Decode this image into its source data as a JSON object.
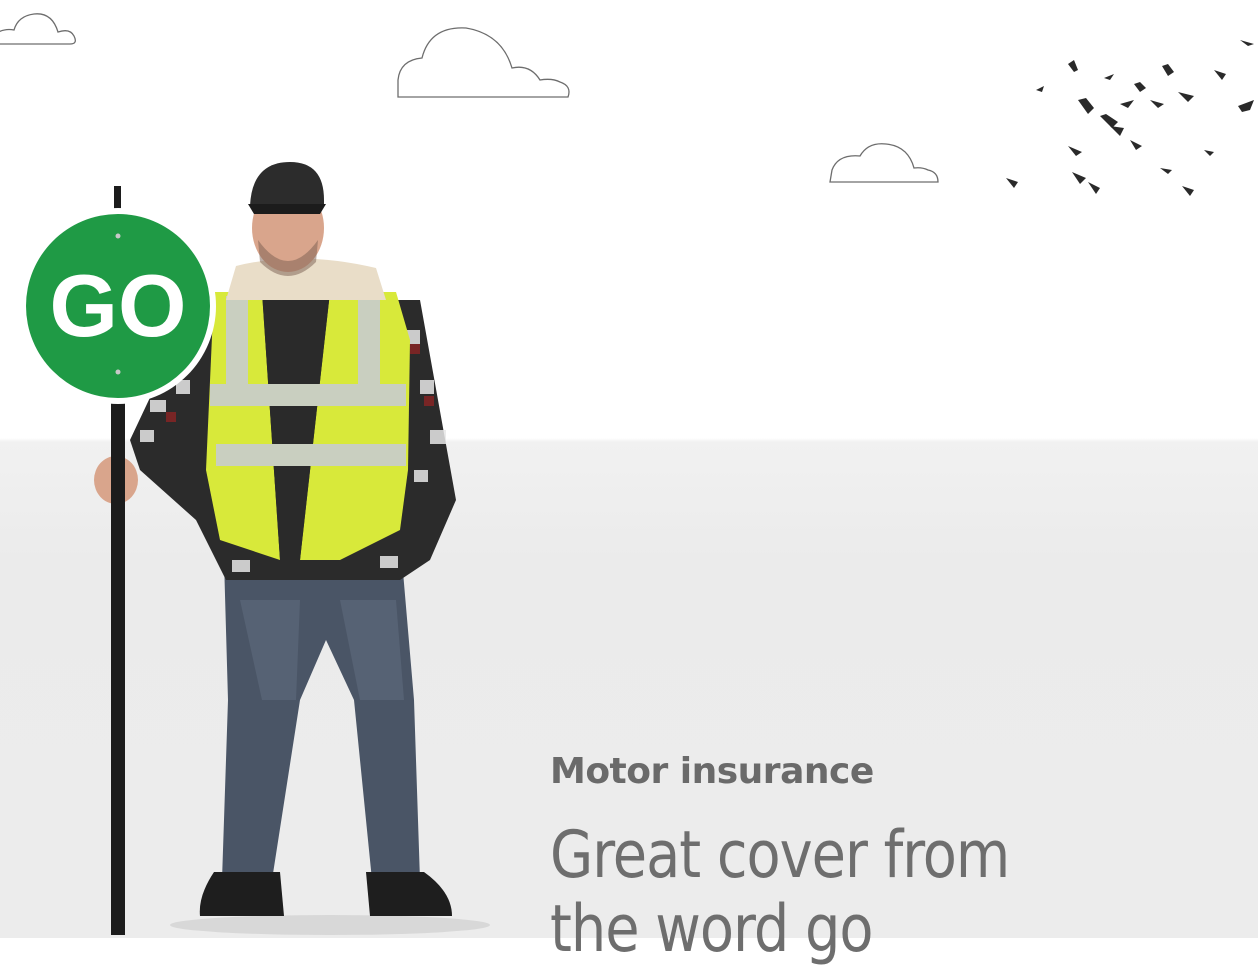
{
  "hero": {
    "sign_text": "GO",
    "eyebrow": "Motor insurance",
    "headline_line1": "Great cover from",
    "headline_line2": "the word go"
  },
  "colors": {
    "sign_green": "#1f9a45",
    "vest_yellow": "#d8e93a",
    "text_grey": "#6e6e6e"
  },
  "icons": [
    "cloud-icon",
    "birds-flock-icon",
    "go-sign-icon"
  ]
}
